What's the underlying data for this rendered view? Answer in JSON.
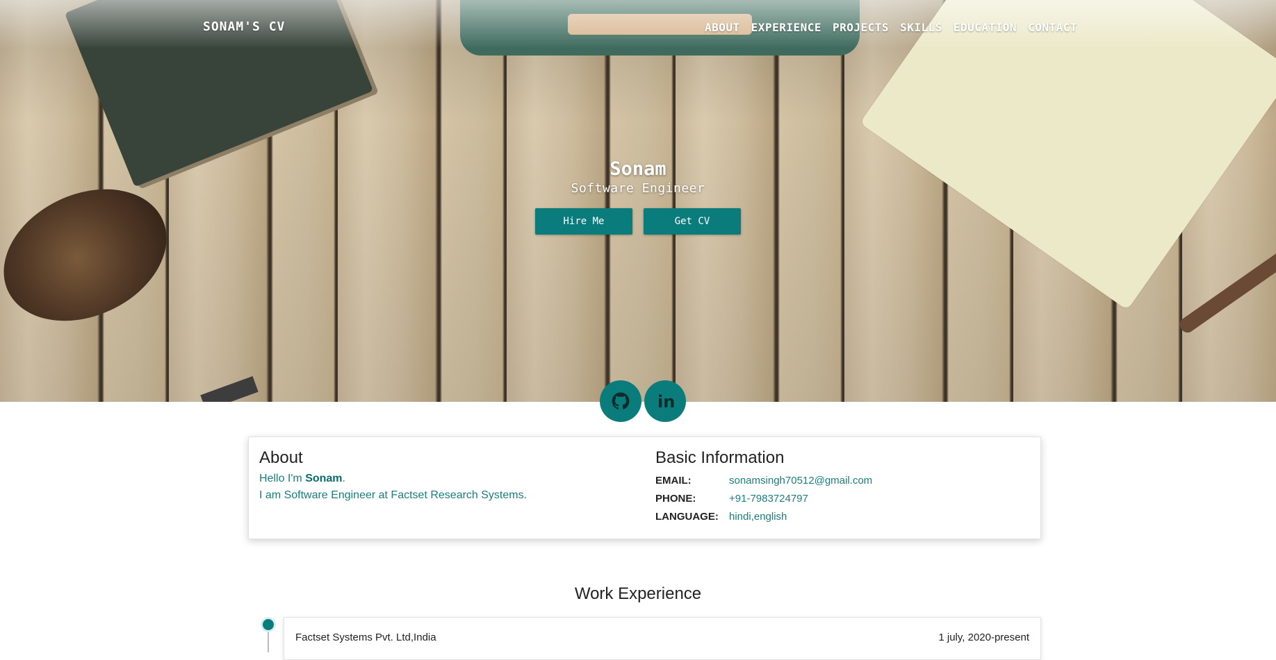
{
  "navbar": {
    "brand": "SONAM'S CV",
    "items": [
      {
        "label": "ABOUT"
      },
      {
        "label": "EXPERIENCE"
      },
      {
        "label": "PROJECTS"
      },
      {
        "label": "SKILLS"
      },
      {
        "label": "EDUCATION"
      },
      {
        "label": "CONTACT"
      }
    ]
  },
  "hero": {
    "name": "Sonam",
    "role": "Software Engineer",
    "hire_button": "Hire Me",
    "cv_button": "Get CV"
  },
  "social": {
    "icons": [
      "github-icon",
      "linkedin-icon"
    ],
    "linkedin_text": "in"
  },
  "about": {
    "title": "About",
    "greeting_prefix": "Hello I'm ",
    "greeting_name": "Sonam",
    "greeting_suffix": ".",
    "line2": "I am Software Engineer at Factset Research Systems."
  },
  "basic_info": {
    "title": "Basic Information",
    "rows": [
      {
        "key": "EMAIL:",
        "value": "sonamsingh70512@gmail.com"
      },
      {
        "key": "PHONE:",
        "value": "+91-7983724797"
      },
      {
        "key": "LANGUAGE:",
        "value": "hindi,english"
      }
    ]
  },
  "work": {
    "title": "Work Experience",
    "entries": [
      {
        "company": "Factset Systems Pvt. Ltd,India",
        "date": "1 july, 2020-present"
      }
    ]
  },
  "colors": {
    "accent": "#0b7c7c",
    "link_text": "#1a7d7d"
  }
}
